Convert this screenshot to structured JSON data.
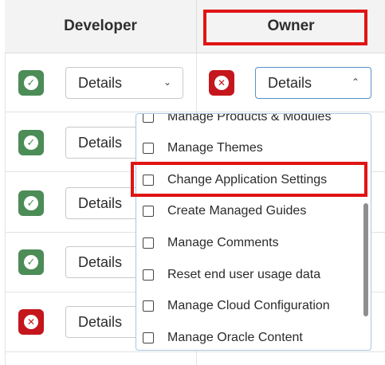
{
  "table": {
    "columns": [
      "Developer",
      "Owner"
    ]
  },
  "details_label": "Details",
  "rows": [
    {
      "developer": "granted",
      "owner": "denied"
    },
    {
      "developer": "granted"
    },
    {
      "developer": "granted"
    },
    {
      "developer": "granted"
    },
    {
      "developer": "denied"
    }
  ],
  "dropdown": {
    "options": [
      "Manage Products & Modules",
      "Manage Themes",
      "Change Application Settings",
      "Create Managed Guides",
      "Manage Comments",
      "Reset end user usage data",
      "Manage Cloud Configuration",
      "Manage Oracle Content"
    ],
    "highlighted_option": "Change Application Settings"
  },
  "icons": {
    "granted": "check-circle-icon",
    "denied": "x-circle-icon",
    "select_closed": "chevron-down-icon",
    "select_open": "chevron-up-icon"
  },
  "colors": {
    "granted": "#4c8c57",
    "denied": "#c4161c",
    "highlight": "#e01414",
    "header_bg": "#f3f3f3",
    "dropdown_border": "#a9c6e6"
  }
}
